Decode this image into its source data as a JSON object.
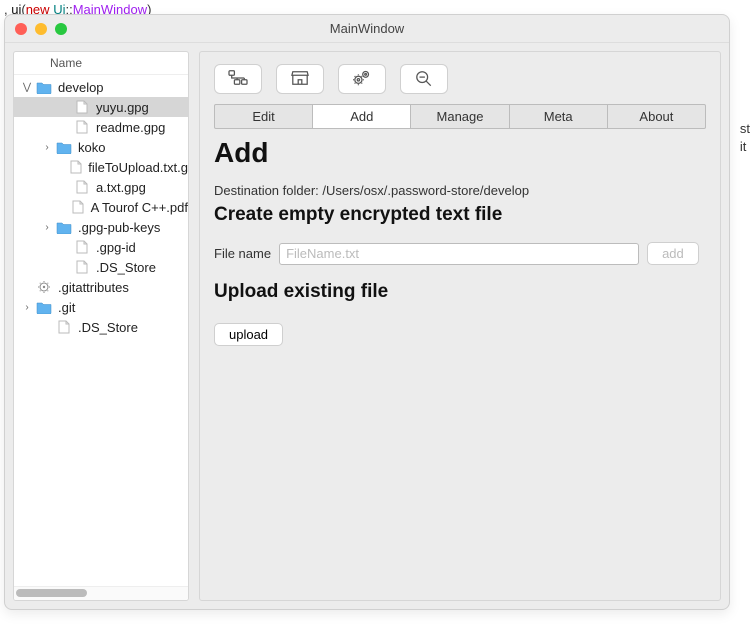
{
  "code_line": {
    "prefix": ", ",
    "ui": "ui",
    "paren_open": "(",
    "new": "new",
    "space": " ",
    "scope": "Ui",
    "sep": "::",
    "cls": "MainWindow",
    "paren_close": ")"
  },
  "window": {
    "title": "MainWindow"
  },
  "tree": {
    "header": "Name",
    "nodes": [
      {
        "level": 0,
        "expand": "down",
        "icon": "folder",
        "label": "develop",
        "selected": false
      },
      {
        "level": 2,
        "icon": "file",
        "label": "yuyu.gpg",
        "selected": true
      },
      {
        "level": 2,
        "icon": "file",
        "label": "readme.gpg"
      },
      {
        "level": 1,
        "expand": "right",
        "icon": "folder",
        "label": "koko"
      },
      {
        "level": 2,
        "icon": "file",
        "label": "fileToUpload.txt.g"
      },
      {
        "level": 2,
        "icon": "file",
        "label": "a.txt.gpg"
      },
      {
        "level": 2,
        "icon": "file",
        "label": "A Tourof C++.pdf"
      },
      {
        "level": 1,
        "expand": "right",
        "icon": "folder",
        "label": ".gpg-pub-keys"
      },
      {
        "level": 2,
        "icon": "file",
        "label": ".gpg-id"
      },
      {
        "level": 2,
        "icon": "file",
        "label": ".DS_Store"
      },
      {
        "level": 0,
        "icon": "gear",
        "label": ".gitattributes"
      },
      {
        "level": 0,
        "expand": "right",
        "icon": "folder",
        "label": ".git"
      },
      {
        "level": 1,
        "icon": "file",
        "label": ".DS_Store"
      }
    ]
  },
  "toolbar_icons": [
    "tree-icon",
    "store-icon",
    "gears-icon",
    "zoom-icon"
  ],
  "tabs": [
    {
      "label": "Edit",
      "active": false
    },
    {
      "label": "Add",
      "active": true
    },
    {
      "label": "Manage",
      "active": false
    },
    {
      "label": "Meta",
      "active": false
    },
    {
      "label": "About",
      "active": false
    }
  ],
  "page": {
    "heading": "Add",
    "destination_label": "Destination folder: ",
    "destination_path": "/Users/osx/.password-store/develop",
    "section_create": "Create empty encrypted text file",
    "filename_label": "File name",
    "filename_placeholder": "FileName.txt",
    "add_button": "add",
    "section_upload": "Upload existing file",
    "upload_button": "upload"
  },
  "right_edge": [
    "st",
    "it"
  ]
}
